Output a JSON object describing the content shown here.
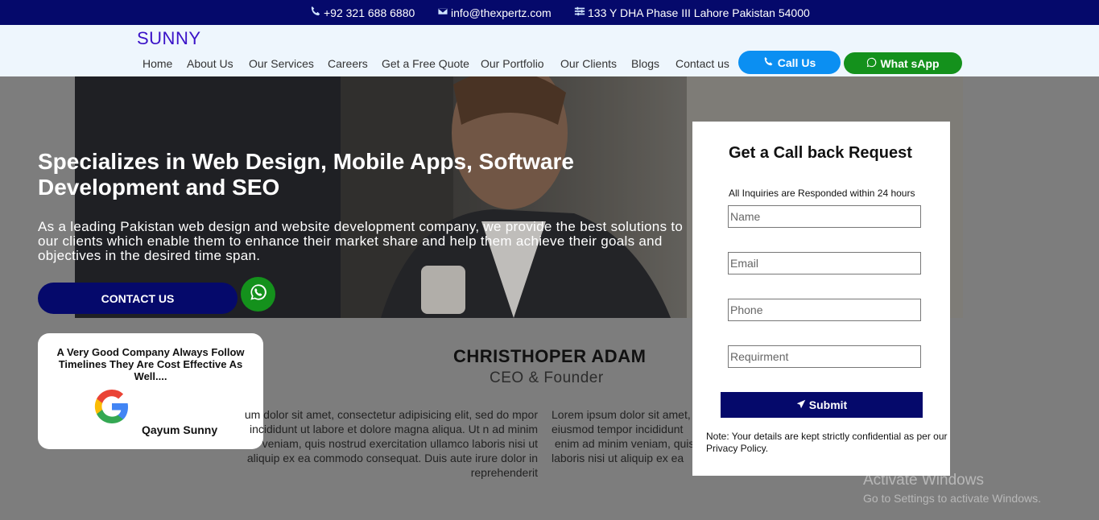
{
  "topbar": {
    "phone": "+92 321 688 6880",
    "email": "info@thexpertz.com",
    "address": "133 Y DHA Phase III Lahore Pakistan 54000"
  },
  "header": {
    "logo": "SUNNY",
    "nav": [
      "Home",
      "About Us",
      "Our Services",
      "Careers",
      "Get a Free Quote",
      "Our Portfolio",
      "Our Clients",
      "Blogs",
      "Contact us"
    ],
    "call_label": "Call Us",
    "whatsapp_label": "What sApp"
  },
  "hero": {
    "title": "Specializes in Web Design, Mobile Apps, Software Development and SEO",
    "text": "As a leading Pakistan web design and website development company, we provide the best solutions to our clients which enable them to enhance their market share and help them achieve their goals and objectives in the desired time span.",
    "contact_label": "CONTACT US"
  },
  "review": {
    "quote": "A Very Good Company Always Follow Timelines They Are Cost Effective As Well....",
    "author": "Qayum Sunny"
  },
  "testimonial": {
    "name": "CHRISTHOPER ADAM",
    "role": "CEO & Founder",
    "col1": "um dolor sit amet, consectetur adipisicing elit, sed do mpor incididunt ut labore et dolore magna aliqua. Ut n ad minim veniam, quis nostrud exercitation ullamco laboris nisi ut aliquip ex ea commodo consequat. Duis aute irure dolor in reprehenderit",
    "col2_lines": [
      "Lorem ipsum dolor sit amet,",
      "eiusmod tempor incididunt",
      " enim ad minim veniam, quis",
      "laboris nisi ut aliquip ex ea"
    ]
  },
  "form": {
    "title": "Get a Call back Request",
    "subtitle": "All Inquiries are Responded within 24 hours",
    "name_placeholder": "Name",
    "email_placeholder": "Email",
    "phone_placeholder": "Phone",
    "requirement_placeholder": "Requirment",
    "submit_label": "Submit",
    "note": "Note: Your details are kept strictly confidential as per our Privacy Policy."
  },
  "watermark": {
    "title": "Activate Windows",
    "subtitle": "Go to Settings to activate Windows."
  },
  "colors": {
    "navy": "#05096b",
    "call_blue": "#0b8ff2",
    "whatsapp_green": "#14911c",
    "logo_purple": "#3a12c8"
  }
}
